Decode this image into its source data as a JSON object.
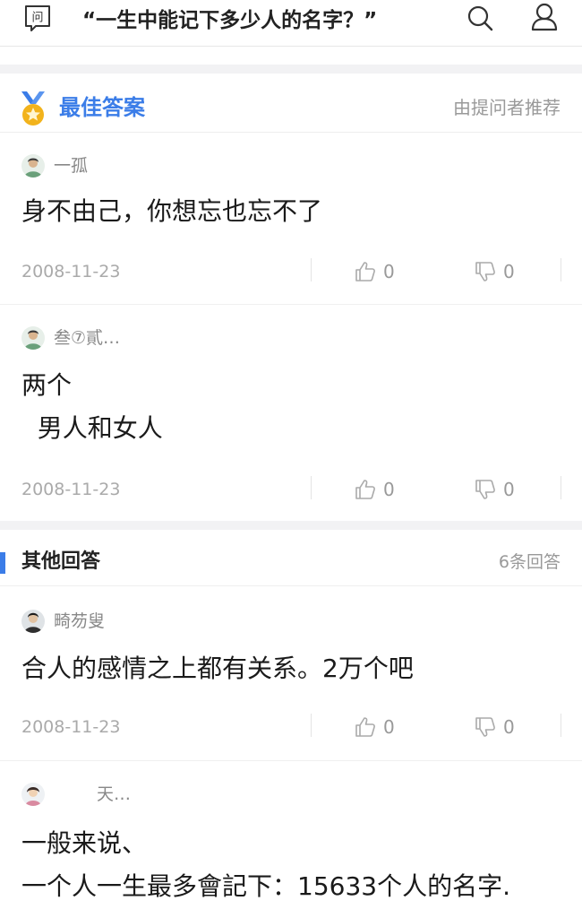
{
  "header": {
    "ask_icon_label": "问",
    "title": "“一生中能记下多少人的名字？”"
  },
  "best": {
    "label": "最佳答案",
    "hint": "由提问者推荐",
    "answers": [
      {
        "user": "一孤",
        "content": "身不由己，你想忘也忘不了",
        "date": "2008-11-23",
        "likes": "0",
        "dislikes": "0"
      },
      {
        "user": "叁⑦貳…",
        "content": "两个\n  男人和女人",
        "date": "2008-11-23",
        "likes": "0",
        "dislikes": "0"
      }
    ]
  },
  "other": {
    "label": "其他回答",
    "count": "6条回答",
    "answers": [
      {
        "user": "畸芴叟",
        "content": "合人的感情之上都有关系。2万个吧",
        "date": "2008-11-23",
        "likes": "0",
        "dislikes": "0"
      },
      {
        "user": "天…",
        "content": "一般来说、\n一个人一生最多會記下：15633个人的名字."
      }
    ]
  },
  "colors": {
    "accent": "#3b7de8",
    "medal_gold": "#f2b31c",
    "medal_ribbon": "#3b7de8"
  },
  "icons": [
    "ask-icon",
    "search-icon",
    "user-icon",
    "medal-icon",
    "thumb-up-icon",
    "thumb-down-icon"
  ]
}
